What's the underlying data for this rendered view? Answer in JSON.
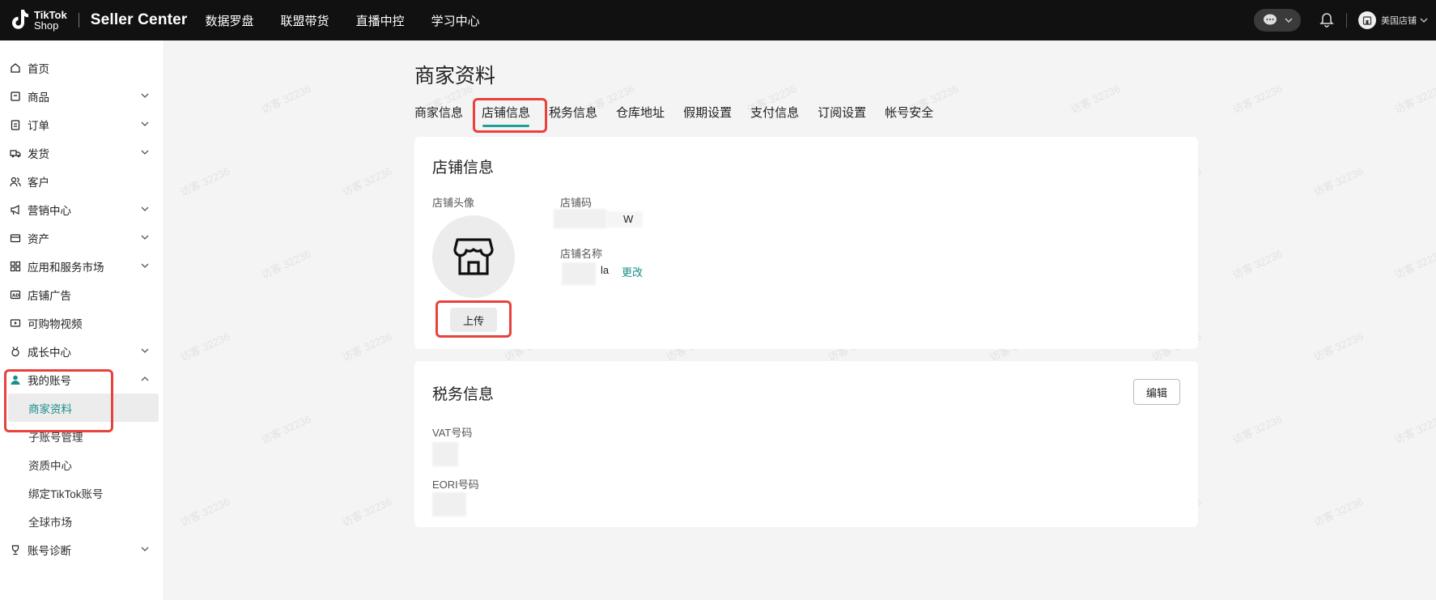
{
  "topbar": {
    "logo_line1": "TikTok",
    "logo_line2": "Shop",
    "title": "Seller Center",
    "nav": [
      "数据罗盘",
      "联盟带货",
      "直播中控",
      "学习中心"
    ],
    "shop_name": "美国店铺"
  },
  "sidebar": {
    "items": [
      {
        "label": "首页",
        "icon": "home-icon"
      },
      {
        "label": "商品",
        "icon": "box-icon"
      },
      {
        "label": "订单",
        "icon": "clipboard-icon"
      },
      {
        "label": "发货",
        "icon": "truck-icon"
      },
      {
        "label": "客户",
        "icon": "users-icon"
      },
      {
        "label": "营销中心",
        "icon": "megaphone-icon"
      },
      {
        "label": "资产",
        "icon": "wallet-icon"
      },
      {
        "label": "应用和服务市场",
        "icon": "apps-icon"
      },
      {
        "label": "店铺广告",
        "icon": "ad-icon"
      },
      {
        "label": "可购物视频",
        "icon": "video-icon"
      },
      {
        "label": "成长中心",
        "icon": "medal-icon"
      },
      {
        "label": "我的账号",
        "icon": "user-icon"
      }
    ],
    "sub_items": [
      "商家资料",
      "子账号管理",
      "资质中心",
      "绑定TikTok账号",
      "全球市场"
    ],
    "last_item": {
      "label": "账号诊断",
      "icon": "trophy-icon"
    }
  },
  "main": {
    "page_title": "商家资料",
    "tabs": [
      "商家信息",
      "店铺信息",
      "税务信息",
      "仓库地址",
      "假期设置",
      "支付信息",
      "订阅设置",
      "帐号安全"
    ],
    "shop_card": {
      "title": "店铺信息",
      "avatar_label": "店铺头像",
      "upload_label": "上传",
      "code_label": "店铺码",
      "code_value_suffix": "W",
      "name_label": "店铺名称",
      "name_value_suffix": "la",
      "change_link": "更改"
    },
    "tax_card": {
      "title": "税务信息",
      "edit_label": "编辑",
      "vat_label": "VAT号码",
      "eori_label": "EORI号码"
    }
  },
  "watermark": "访客 32236",
  "colors": {
    "accent": "#1fa197",
    "highlight": "#e8423c",
    "topbar": "#111111"
  }
}
